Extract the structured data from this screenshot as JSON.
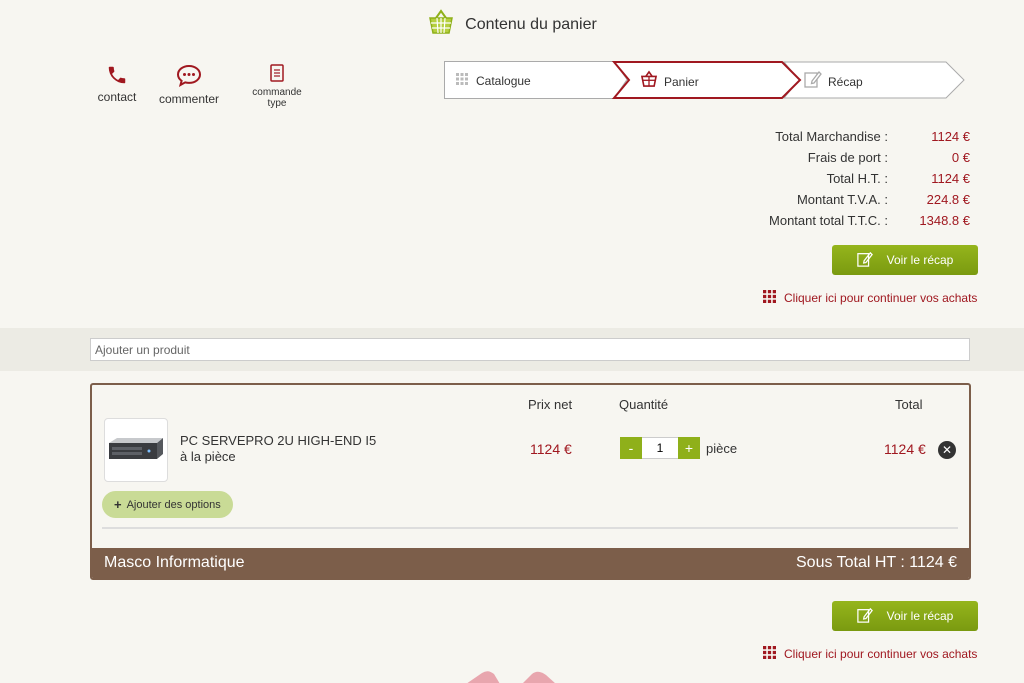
{
  "header": {
    "title": "Contenu du panier",
    "icon": "basket-icon"
  },
  "quick_links": [
    {
      "label": "contact",
      "icon": "phone-icon"
    },
    {
      "label": "commenter",
      "icon": "comment-icon"
    },
    {
      "label_line1": "commande",
      "label_line2": "type",
      "icon": "document-icon"
    }
  ],
  "stepper": {
    "steps": [
      {
        "label": "Catalogue",
        "icon": "grid-icon",
        "active": false
      },
      {
        "label": "Panier",
        "icon": "basket-icon",
        "active": true
      },
      {
        "label": "Récap",
        "icon": "edit-icon",
        "active": false
      }
    ]
  },
  "totals": [
    {
      "label": "Total Marchandise :",
      "value": "1124 €"
    },
    {
      "label": "Frais de port :",
      "value": "0 €"
    },
    {
      "label": "Total H.T. :",
      "value": "1124 €"
    },
    {
      "label": "Montant T.V.A. :",
      "value": "224.8 €"
    },
    {
      "label": "Montant total T.T.C. :",
      "value": "1348.8 €"
    }
  ],
  "actions": {
    "recap_label": "Voir le récap",
    "continue_label": "Cliquer ici pour continuer vos achats"
  },
  "add_product": {
    "placeholder": "Ajouter un produit"
  },
  "cart": {
    "columns": {
      "price": "Prix net",
      "qty": "Quantité",
      "total": "Total"
    },
    "item": {
      "name": "PC SERVEPRO 2U HIGH-END I5",
      "subtitle": "à la pièce",
      "price": "1124 €",
      "quantity": "1",
      "unit": "pièce",
      "total": "1124 €"
    },
    "options_label": "Ajouter des options",
    "vendor": "Masco Informatique",
    "subtotal": "Sous Total HT : 1124 €"
  },
  "colors": {
    "accent_red": "#a01820",
    "accent_green": "#8fb01a",
    "brown": "#7c5e4a"
  }
}
